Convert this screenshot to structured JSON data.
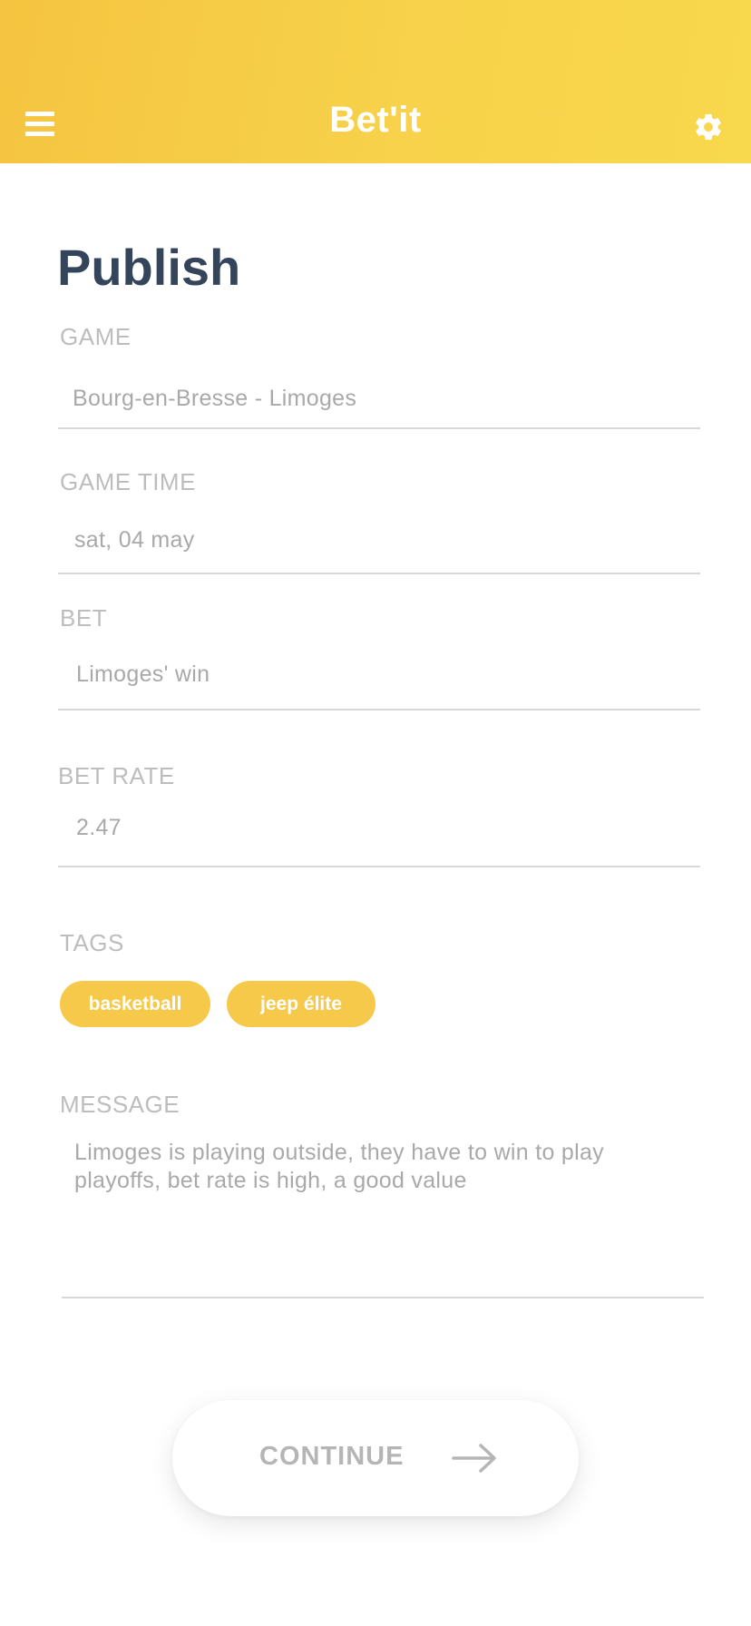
{
  "header": {
    "app_title": "Bet'it",
    "menu_icon": "hamburger-menu-icon",
    "settings_icon": "gear-icon",
    "gradient_start": "#f5c440",
    "gradient_end": "#f8d84c"
  },
  "page": {
    "title": "Publish"
  },
  "form": {
    "game": {
      "label": "GAME",
      "value": "Bourg-en-Bresse - Limoges"
    },
    "game_time": {
      "label": "GAME TIME",
      "value": "sat, 04 may"
    },
    "bet": {
      "label": "BET",
      "value": "Limoges' win"
    },
    "bet_rate": {
      "label": "BET RATE",
      "value": "2.47"
    },
    "tags": {
      "label": "TAGS",
      "items": [
        "basketball",
        "jeep élite"
      ]
    },
    "message": {
      "label": "MESSAGE",
      "value": "Limoges is playing outside, they have to win to play playoffs, bet rate is high, a good value"
    }
  },
  "actions": {
    "continue_label": "CONTINUE",
    "continue_icon": "arrow-right-icon"
  },
  "colors": {
    "accent": "#f6c94a",
    "title": "#34445a",
    "label": "#bdbdbd",
    "value": "#a9a9a9"
  }
}
